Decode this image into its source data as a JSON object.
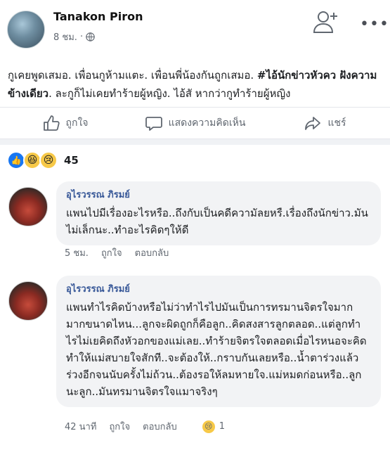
{
  "post": {
    "author": "Tanakon Piron",
    "time": "8 ชม.",
    "text_part1": "กูเคยพูดเสมอ. เพื่อนกูห้ามแตะ. เพื่อนพี่น้องกันถูกเสมอ. ",
    "text_bold": "#ไอ้นักข่าวหัวคว  ฝังความข้างเดียว",
    "text_part2": ". ละกูก็ไม่เคยทำร้ายผู้หญิง. ไอ้สั  หากว่ากูทำร้ายผู้หญิง"
  },
  "actions": {
    "like": "ถูกใจ",
    "comment": "แสดงความคิดเห็น",
    "share": "แชร์"
  },
  "reactions": {
    "count": "45",
    "like_icon": "thumbs-up-icon",
    "haha_icon": "laugh-emoji-icon",
    "sad_icon": "sad-emoji-icon"
  },
  "comments": [
    {
      "name": "อุไรวรรณ ภิรมย์",
      "text": "แพนไปมีเรื่องอะไรหรือ..ถึงกับเป็นคดีความัลยหรื.เรื่องถึงนักข่าว.มันไม่เล็กนะ..ทำอะไรคิดๆให้ดี",
      "time": "5 ชม.",
      "like": "ถูกใจ",
      "reply": "ตอบกลับ"
    },
    {
      "name": "อุไรวรรณ ภิรมย์",
      "text": "แพนทำไรคิดบ้างหรือไม่ว่าทำไรไปมันเป็นการทรมานจิตรใจมากมากขนาดไหน...ลูกจะผิดถูกก็คือลูก..คิดสงสารลูกตลอด..แต่ลูกทำไรไม่เยคิดถึงหัวอกของแม่เลย..ทำร้ายจิตรใจตลอดเมื่อไรหนอจะคิดทำให้แม่สบายใจสักที..จะต้องให้..กราบกันเลยหรือ..น้ำตาร่วงแล้วร่วงอีกจนนับครั้งไม่ถ้วน..ต้องรอให้ลมหายใจ.แม่หมดก่อนหรือ..ลูกนะลูก..มันทรมานจิตรใจแมาจริงๆ",
      "time": "42 นาที",
      "like": "ถูกใจ",
      "reply": "ตอบกลับ",
      "reaction_count": "1"
    }
  ]
}
